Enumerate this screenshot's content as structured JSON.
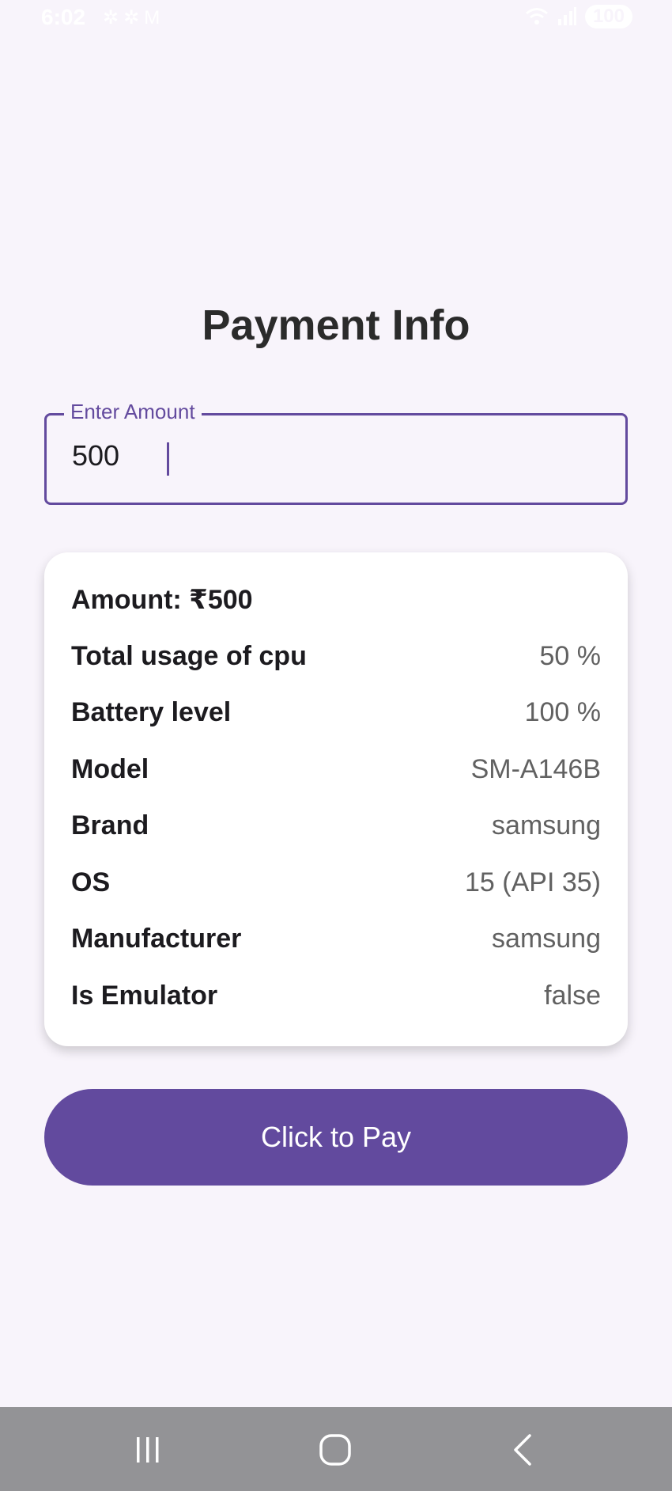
{
  "status_bar": {
    "time": "6:02",
    "battery": "100",
    "icons": [
      "settings-icon",
      "settings-icon",
      "gmail-icon",
      "wifi-icon",
      "signal-icon",
      "battery-icon"
    ]
  },
  "page": {
    "title": "Payment Info"
  },
  "amount_field": {
    "label": "Enter Amount",
    "value": "500"
  },
  "card": {
    "amount_text": "Amount: ₹500",
    "rows": [
      {
        "key": "Total usage of cpu",
        "value": "50 %"
      },
      {
        "key": "Battery level",
        "value": "100 %"
      },
      {
        "key": "Model",
        "value": "SM-A146B"
      },
      {
        "key": "Brand",
        "value": "samsung"
      },
      {
        "key": "OS",
        "value": "15 (API 35)"
      },
      {
        "key": "Manufacturer",
        "value": "samsung"
      },
      {
        "key": "Is Emulator",
        "value": "false"
      }
    ]
  },
  "pay_button": {
    "label": "Click to Pay"
  },
  "nav": {
    "icons": [
      "recent-apps-icon",
      "home-icon",
      "back-icon"
    ]
  },
  "colors": {
    "accent": "#634a9e",
    "background": "#f8f4fb",
    "card": "#ffffff",
    "nav_bar": "#939396"
  }
}
